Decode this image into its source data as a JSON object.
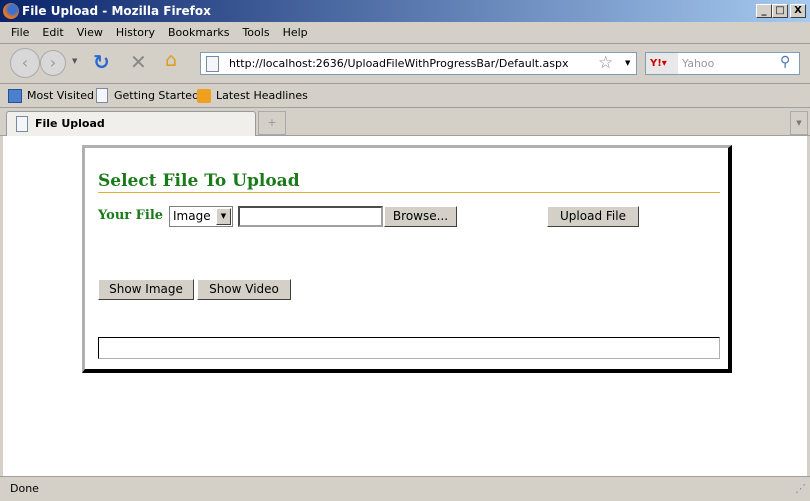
{
  "window": {
    "title": "File Upload - Mozilla Firefox",
    "minimize": "_",
    "maximize": "□",
    "close": "X"
  },
  "menu": [
    "File",
    "Edit",
    "View",
    "History",
    "Bookmarks",
    "Tools",
    "Help"
  ],
  "nav": {
    "url": "http://localhost:2636/UploadFileWithProgressBar/Default.aspx",
    "search_placeholder": "Yahoo",
    "back": "‹",
    "forward": "›"
  },
  "bookmarks": [
    "Most Visited",
    "Getting Started",
    "Latest Headlines"
  ],
  "tabs": [
    {
      "label": "File Upload",
      "active": true
    }
  ],
  "page": {
    "heading": "Select File To Upload",
    "your_file_label": "Your File",
    "file_type_select": "Image",
    "browse_button": "Browse...",
    "upload_button": "Upload File",
    "show_image_button": "Show Image",
    "show_video_button": "Show Video",
    "progress_percent": 0,
    "colors": {
      "heading": "#1a7a1a",
      "underline": "#e0b030"
    }
  },
  "status": "Done"
}
